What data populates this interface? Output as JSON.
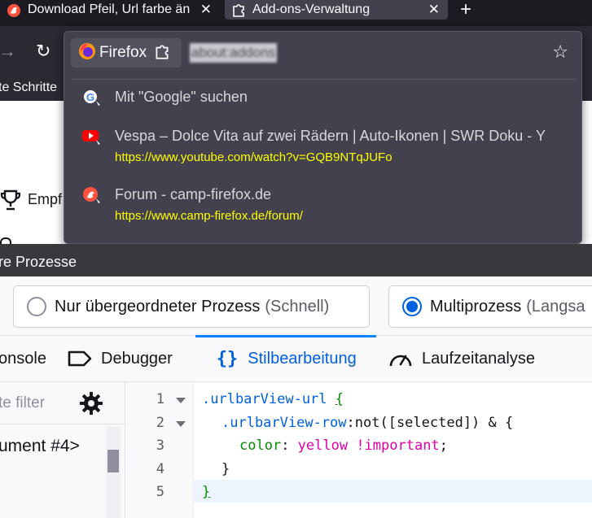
{
  "tabs": [
    {
      "title": "Download Pfeil, Url farbe än",
      "close": "✕"
    },
    {
      "title": "Add-ons-Verwaltung",
      "close": "✕"
    }
  ],
  "newtab": "+",
  "nav": {
    "forward": "→",
    "reload": "↻",
    "bookmark_text": "te Schritte"
  },
  "page": {
    "partial_text": "Empf"
  },
  "urlbar": {
    "identity_label": "Firefox",
    "url_text": "about:addons",
    "star": "☆",
    "results": [
      {
        "title": "Mit \"Google\" suchen",
        "url": ""
      },
      {
        "title": "Vespa – Dolce Vita auf zwei Rädern | Auto-Ikonen | SWR Doku - Y",
        "url": "https://www.youtube.com/watch?v=GQB9NTqJUFo"
      },
      {
        "title": "Forum - camp-firefox.de",
        "url": "https://www.camp-firefox.de/forum/"
      }
    ]
  },
  "devtools": {
    "header": "re Prozesse",
    "radio1": {
      "label": "Nur übergeordneter Prozess",
      "hint": "(Schnell)"
    },
    "radio2": {
      "label": "Multiprozess",
      "hint": "(Langsa"
    },
    "tabs": {
      "console": "onsole",
      "debugger": "Debugger",
      "style": "Stilbearbeitung",
      "perf": "Laufzeitanalyse"
    },
    "filter_placeholder": "te filter",
    "stylesheet_name": "ument #4>",
    "code": {
      "line_numbers": [
        "1",
        "2",
        "3",
        "4",
        "5"
      ],
      "l1_selector": ".urlbarView-url",
      "l1_brace": "{",
      "l2_selector": ".urlbarView-row",
      "l2_pseudo": ":not([selected]) & {",
      "l3_prop": "color",
      "l3_colon": ": ",
      "l3_value": "yellow !important",
      "l3_end": ";",
      "l4": "}",
      "l5": "}"
    }
  },
  "colors": {
    "url_yellow": "#ffff00",
    "accent_blue": "#0060df",
    "panel_bg": "#42414d"
  }
}
